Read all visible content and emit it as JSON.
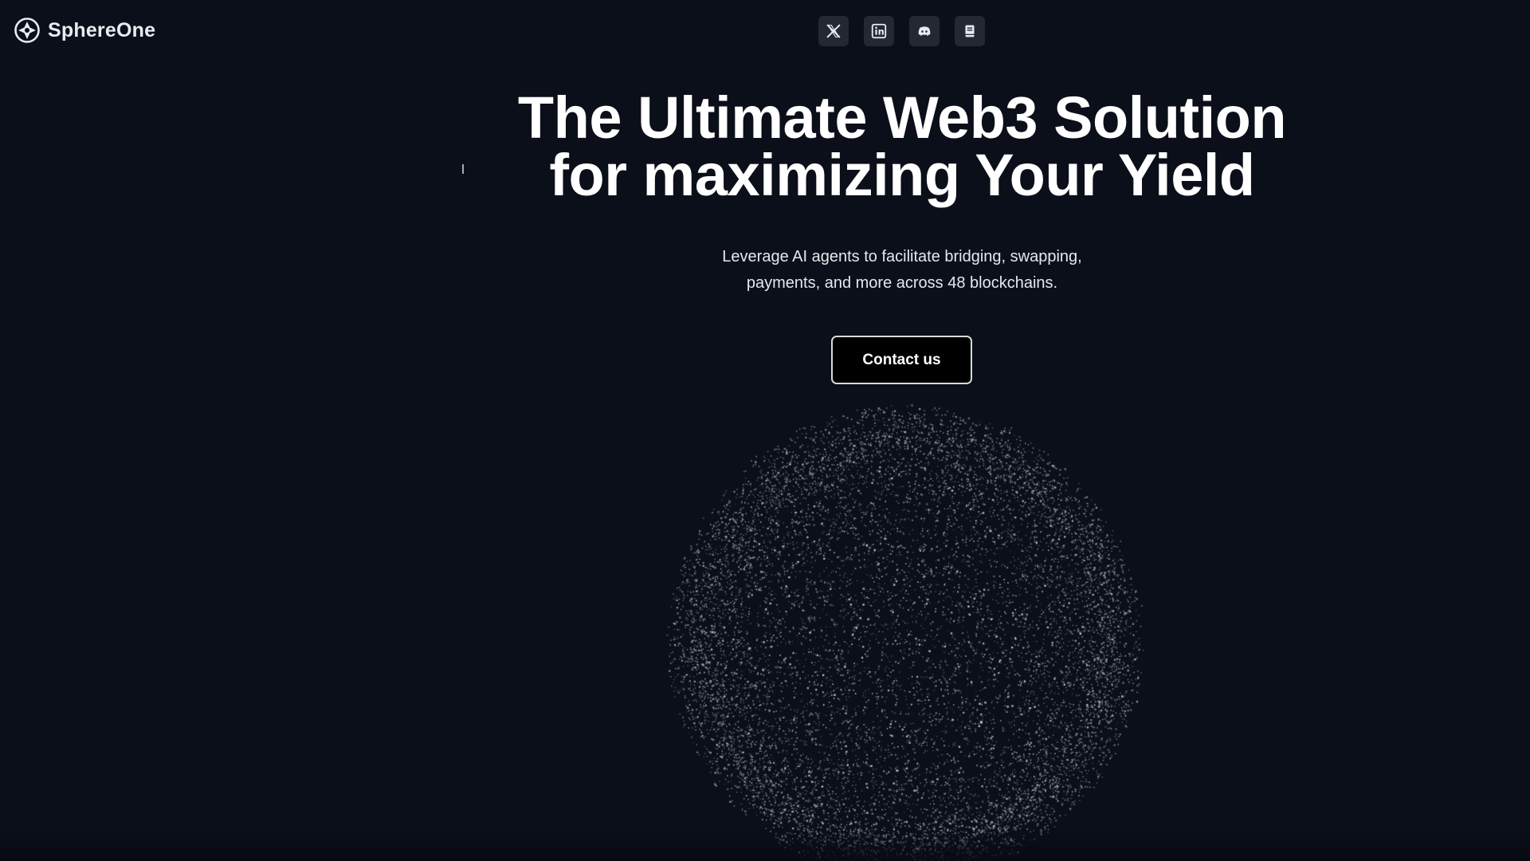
{
  "header": {
    "brand_name": "SphereOne",
    "brand_icon": "sphereone-logo-icon",
    "socials": [
      {
        "name": "x-twitter-icon"
      },
      {
        "name": "linkedin-icon"
      },
      {
        "name": "discord-icon"
      },
      {
        "name": "docs-book-icon"
      }
    ]
  },
  "hero": {
    "title_line1": "The Ultimate Web3 Solution",
    "title_line2": "for maximizing Your Yield",
    "subtitle_line1": "Leverage AI agents to facilitate bridging, swapping,",
    "subtitle_line2": "payments, and more across 48 blockchains.",
    "cta_label": "Contact us"
  },
  "colors": {
    "background": "#0b0f1a",
    "text": "#ffffff",
    "social_button_bg": "#242833",
    "cta_bg": "#000000",
    "cta_border": "#d7d9de",
    "particles": "#d9dce2"
  },
  "visual": {
    "particle_sphere_icon": "particle-sphere-visual"
  }
}
